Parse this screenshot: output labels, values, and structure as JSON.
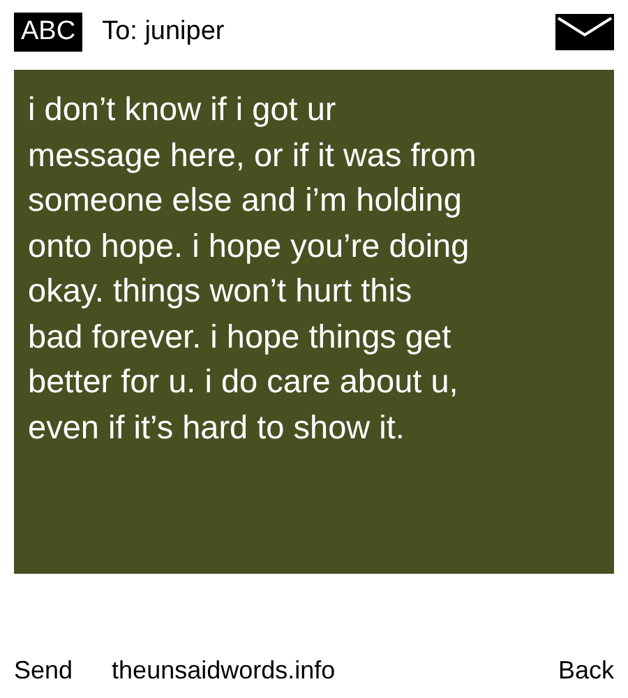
{
  "header": {
    "mode": "ABC",
    "recipient": "To: juniper"
  },
  "message": {
    "text": "i don’t know if i got ur\nmessage here, or if it was from\nsomeone else and i’m holding\nonto hope. i hope you’re doing\nokay. things won’t hurt this\nbad forever. i hope things get\nbetter for u. i do care about u,\neven if it’s hard to show it."
  },
  "footer": {
    "left": "Send",
    "site": "theunsaidwords.info",
    "right": "Back"
  }
}
